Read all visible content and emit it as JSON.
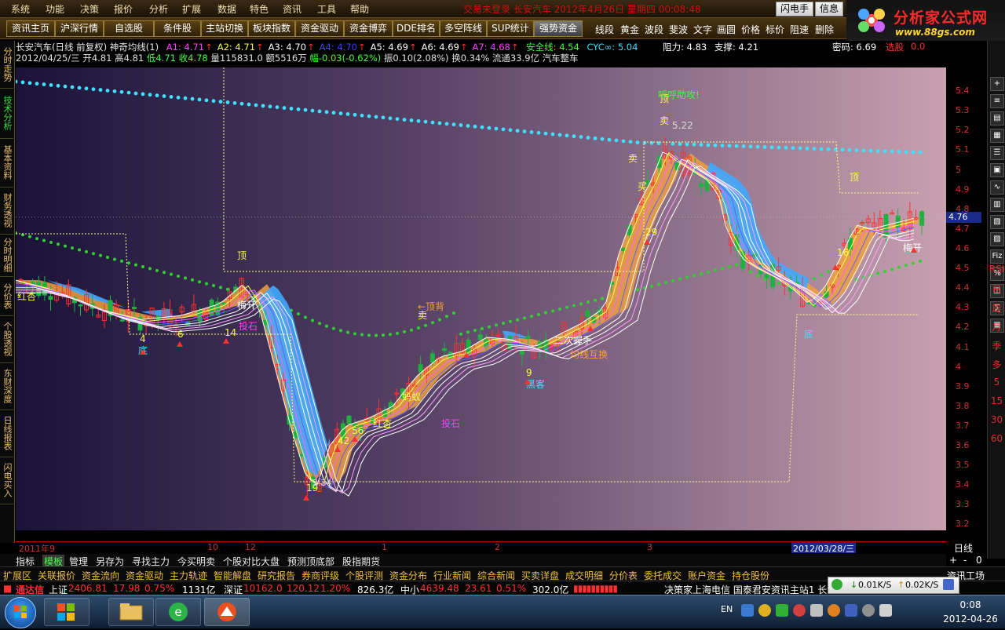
{
  "menu": {
    "items": [
      "系统",
      "功能",
      "决策",
      "报价",
      "分析",
      "扩展",
      "数据",
      "特色",
      "资讯",
      "工具",
      "帮助"
    ],
    "marquee": "交易未登录   长安汽车 2012年4月26日 星期四 00:08:48",
    "flash_btn": "闪电手",
    "info_btn": "信息"
  },
  "logo": {
    "name": "分析家公式网",
    "url_text": "www.88gs.com"
  },
  "toolbar": {
    "buttons": [
      "资讯主页",
      "沪深行情",
      "自选股",
      "条件股",
      "主站切换",
      "板块指数",
      "资金驱动",
      "资金博弈",
      "DDE排名",
      "多空阵线",
      "SUP统计",
      "强势资金"
    ],
    "active": "强势资金",
    "draw_tools": [
      "线段",
      "黄金",
      "波段",
      "斐波",
      "文字",
      "画圆",
      "价格",
      "标价",
      "阻速",
      "删除"
    ]
  },
  "left_tabs": [
    "分时走势",
    "技术分析",
    "基本资料",
    "财务透视",
    "分时明细",
    "分价表",
    "个股透视",
    "东财深度",
    "日线报表",
    "闪电买入"
  ],
  "left_tab_active": "技术分析",
  "header": {
    "title": "长安汽车(日线 前复权) 神奇均线(1)",
    "ma": [
      {
        "label": "A1: 4.71",
        "color": "#ff40ff"
      },
      {
        "label": "A2: 4.71",
        "color": "#ffff40"
      },
      {
        "label": "A3: 4.70",
        "color": "#ffffff"
      },
      {
        "label": "A4: 4.70",
        "color": "#4040ff"
      },
      {
        "label": "A5: 4.69",
        "color": "#ffffff"
      },
      {
        "label": "A6: 4.69",
        "color": "#ffffff"
      },
      {
        "label": "A7: 4.68",
        "color": "#ff40ff"
      }
    ],
    "safe_line": "安全线: 4.54",
    "cyc": "CYC∞: 5.04",
    "resistance": "阻力: 4.83",
    "support": "支撑: 4.21",
    "density": "密码: 6.69",
    "select": "选股",
    "select_val": "0.0",
    "line2": {
      "date": "2012/04/25/三",
      "open": "开4.81",
      "high": "高4.81",
      "low": "低4.71",
      "close": "收4.78",
      "vol": "量115831.0",
      "amount": "额5516万",
      "change": "幅-0.03(-0.62%)",
      "amp": "振0.10(2.08%)",
      "turn": "换0.34%",
      "float": "流通33.9亿",
      "industry": "汽车整车"
    }
  },
  "chart_data": {
    "type": "candlestick",
    "title": "长安汽车(日线 前复权) 神奇均线(1)",
    "ylim": [
      3.17,
      5.52
    ],
    "yticks": [
      5.4,
      5.3,
      5.2,
      5.1,
      5.0,
      4.9,
      4.8,
      4.7,
      4.6,
      4.5,
      4.4,
      4.3,
      4.2,
      4.1,
      4.0,
      3.9,
      3.8,
      3.7,
      3.6,
      3.5,
      3.4,
      3.3,
      3.2
    ],
    "current_price": 4.76,
    "x_labels": [
      "2011年9",
      "10",
      "12",
      "1",
      "2",
      "3"
    ],
    "x_highlight": "2012/03/28/三",
    "extremes": {
      "high": "5.22",
      "low": "3.34"
    },
    "annotations": [
      "红杏",
      "底",
      "顶",
      "梅开",
      "投石",
      "←顶背",
      "卖",
      "红杏",
      "蚂蚁",
      "二次握手",
      "均线互换",
      "黑客",
      "顶",
      "卖",
      "5.22",
      "卖",
      "买",
      "投石",
      "顶",
      "梅开",
      "底",
      "呼呼助攻!",
      "9",
      "19",
      "29",
      "42",
      "56",
      "14",
      "6",
      "4",
      "16"
    ],
    "price_series_bands": "8 moving averages with orange/blue fill"
  },
  "right_tools": [
    "RSI",
    "日",
    "周",
    "月",
    "季",
    "多",
    "5",
    "15",
    "30",
    "60"
  ],
  "right_bottom": {
    "label": "日线",
    "plus": "+",
    "minus": "-",
    "num": "0"
  },
  "tabs1": [
    "指标",
    "模板",
    "管理",
    "另存为",
    "寻找主力",
    "今买明卖",
    "个股对比大盘",
    "预测顶底部",
    "股指期货"
  ],
  "tabs1_active": "模板",
  "tabs2": [
    "扩展区",
    "关联报价",
    "资金流向",
    "资金驱动",
    "主力轨迹",
    "智能解盘",
    "研究报告",
    "券商评级",
    "个股评测",
    "资金分布",
    "行业新闻",
    "综合新闻",
    "买卖详盘",
    "成交明细",
    "分价表",
    "委托成交",
    "账户资金",
    "持仓股份",
    "资讯工场"
  ],
  "ticker": {
    "brand": "通达信",
    "sh": {
      "name": "上证",
      "val": "2406.81",
      "chg": "17.98",
      "pct": "0.75%",
      "amt": "1131亿"
    },
    "sz": {
      "name": "深证",
      "val": "10162.0",
      "chg": "120.12",
      "pct": "1.20%",
      "amt": "826.3亿"
    },
    "zx": {
      "name": "中小",
      "val": "4639.48",
      "chg": "23.61",
      "pct": "0.51%",
      "amt": "302.0亿"
    },
    "scroll": "决策家上海电信 国泰君安资讯主站1 长"
  },
  "net": {
    "down": "0.01K/S",
    "up": "0.02K/S"
  },
  "taskbar": {
    "lang": "EN",
    "time": "0:08",
    "date": "2012-04-26"
  },
  "colors": {
    "up": "#ff3030",
    "down": "#20b040",
    "accent": "#ffd52a",
    "band_orange": "#f0a040",
    "band_blue": "#40a8ff",
    "cyan_dots": "#40e0ff",
    "green_dots": "#30d030"
  }
}
